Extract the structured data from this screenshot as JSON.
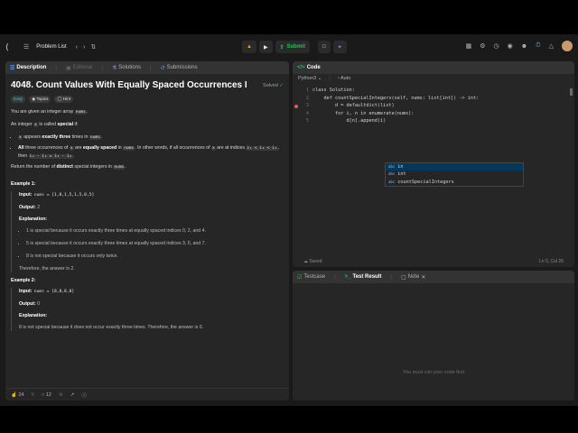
{
  "nav": {
    "problem_list": "Problem List",
    "submit": "Submit"
  },
  "left_tabs": {
    "description": "Description",
    "editorial": "Editorial",
    "solutions": "Solutions",
    "submissions": "Submissions"
  },
  "problem": {
    "title": "4048. Count Values With Equally Spaced Occurrences I",
    "solved": "Solved",
    "difficulty": "Easy",
    "topics": "Topics",
    "hint": "Hint",
    "p1_a": "You are given an integer array ",
    "p1_code": "nums",
    "p2_a": "An integer ",
    "p2_code": "x",
    "p2_b": " is called ",
    "p2_bold": "special",
    "p2_c": " if:",
    "b1_code": "x",
    "b1_a": " appears ",
    "b1_bold": "exactly three",
    "b1_b": " times in ",
    "b1_code2": "nums",
    "b2_bold1": "All",
    "b2_a": " three occurrences of ",
    "b2_code": "x",
    "b2_b": " are ",
    "b2_bold2": "equally spaced",
    "b2_c": " in ",
    "b2_code2": "nums",
    "b2_d": ". In other words, if all occurrences of ",
    "b2_code3": "x",
    "b2_e": " are at indices ",
    "b2_code4": "i₁ < i₂ < i₃",
    "b2_f": ", then ",
    "b2_code5": "i₂ - i₁ = i₃ - i₂",
    "p3_a": "Return the number of ",
    "p3_bold": "distinct",
    "p3_b": " special integers in ",
    "p3_code": "nums"
  },
  "example1": {
    "heading": "Example 1:",
    "input_label": "Input:",
    "input": "nums = [1,8,1,5,1,5,8,5]",
    "output_label": "Output:",
    "output": "2",
    "explanation_label": "Explanation:",
    "items": [
      "1 is special because it occurs exactly three times at equally spaced indices 0, 2, and 4.",
      "5 is special because it occurs exactly three times at equally spaced indices 3, 5, and 7.",
      "8 is not special because it occurs only twice."
    ],
    "conclusion": "Therefore, the answer is 2."
  },
  "example2": {
    "heading": "Example 2:",
    "input_label": "Input:",
    "input": "nums = [8,8,8,8]",
    "output_label": "Output:",
    "output": "0",
    "explanation_label": "Explanation:",
    "text": "8 is not special because it does not occur exactly three times. Therefore, the answer is 0."
  },
  "bottom": {
    "likes": "24",
    "comments": "12"
  },
  "code_panel": {
    "tab": "Code",
    "language": "Python3",
    "auto": "Auto",
    "lines": [
      {
        "n": "1",
        "text": "class Solution:"
      },
      {
        "n": "2",
        "text": "    def countSpecialIntegers(self, nums: list[int]) -> int:"
      },
      {
        "n": "3",
        "text": "        d = defaultdict(list)"
      },
      {
        "n": "4",
        "text": "        for i, n in enumerate(nums):"
      },
      {
        "n": "5",
        "text": "            d[n].append(i)"
      }
    ],
    "autocomplete": [
      "in",
      "int",
      "countSpecialIntegers"
    ],
    "saved": "Saved",
    "cursor": "Ln 5, Col 26"
  },
  "test_panel": {
    "testcase": "Testcase",
    "test_result": "Test Result",
    "note": "Note",
    "empty": "You must run your code first"
  }
}
